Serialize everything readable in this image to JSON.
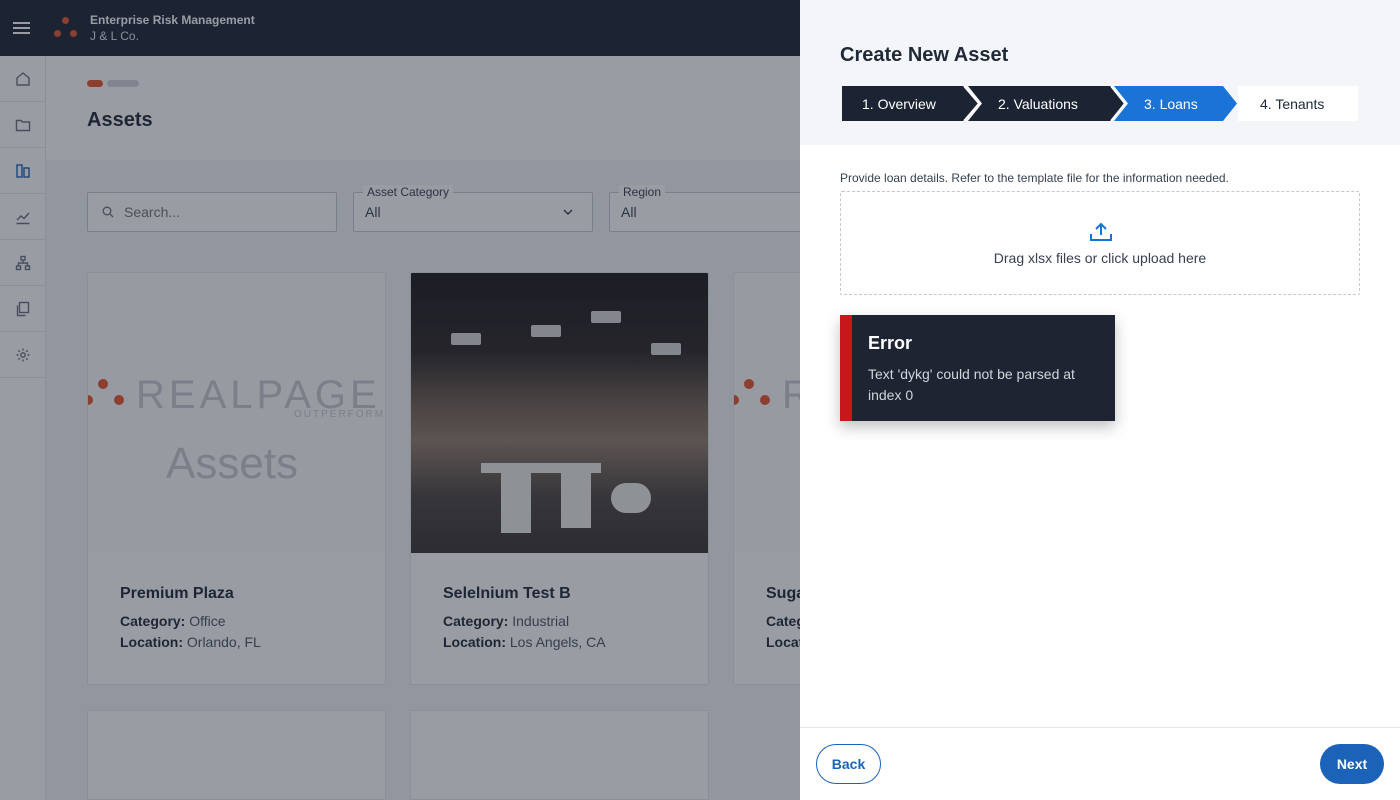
{
  "header": {
    "app_name": "Enterprise Risk Management",
    "company": "J & L Co."
  },
  "rail": {
    "items": [
      {
        "icon": "home-icon"
      },
      {
        "icon": "folder-icon"
      },
      {
        "icon": "assets-icon",
        "active": true
      },
      {
        "icon": "analytics-icon"
      },
      {
        "icon": "hierarchy-icon"
      },
      {
        "icon": "copy-icon"
      },
      {
        "icon": "gear-icon"
      }
    ]
  },
  "page": {
    "title": "Assets"
  },
  "filters": {
    "search_placeholder": "Search...",
    "asset_category": {
      "label": "Asset Category",
      "value": "All"
    },
    "region": {
      "label": "Region",
      "value": "All"
    }
  },
  "cards": [
    {
      "name": "Premium Plaza",
      "category_label": "Category:",
      "category": "Office",
      "location_label": "Location:",
      "location": "Orlando, FL",
      "logo_word": "REALPAGE",
      "logo_sub": "OUTPERFORM",
      "logo_caption": "Assets"
    },
    {
      "name": "Selelnium Test B",
      "category_label": "Category:",
      "category": "Industrial",
      "location_label": "Location:",
      "location": "Los Angels, CA"
    },
    {
      "name": "Suga",
      "category_label": "Categ",
      "location_label": "Locat",
      "logo_word": "R"
    }
  ],
  "drawer": {
    "title": "Create New Asset",
    "steps": [
      {
        "label": "1. Overview",
        "state": "done"
      },
      {
        "label": "2. Valuations",
        "state": "done"
      },
      {
        "label": "3. Loans",
        "state": "active"
      },
      {
        "label": "4. Tenants",
        "state": "pending"
      }
    ],
    "instructions": "Provide loan details. Refer to the template file for the information needed.",
    "dropzone_text": "Drag xlsx files or click upload here",
    "error": {
      "title": "Error",
      "message": "Text 'dykg' could not be parsed at index 0"
    },
    "back_label": "Back",
    "next_label": "Next"
  },
  "colors": {
    "header_bg": "#1c2433",
    "accent": "#1a63b8",
    "brand_orange": "#e8562a",
    "error_red": "#c8161d",
    "step_done": "#1c2433"
  }
}
